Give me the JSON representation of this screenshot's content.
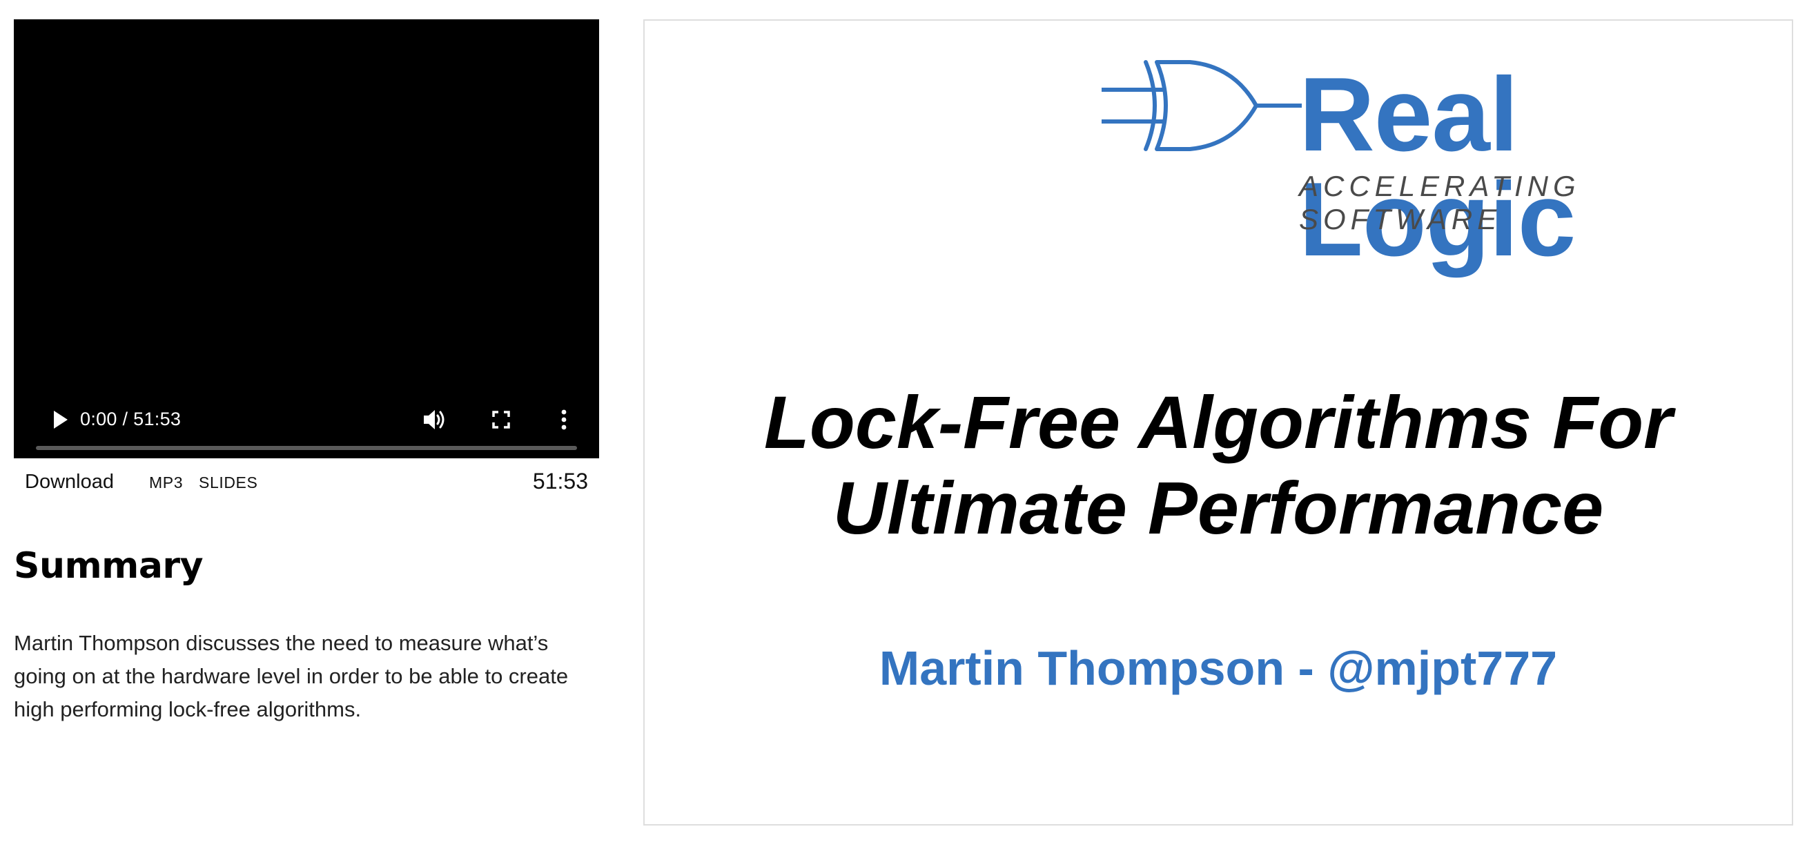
{
  "video": {
    "time_display": "0:00 / 51:53",
    "progress": 0,
    "icons": {
      "play": "play-icon",
      "volume": "volume-icon",
      "fullscreen": "fullscreen-icon",
      "more": "more-vertical-icon"
    }
  },
  "download_bar": {
    "download_label": "Download",
    "links": [
      "MP3",
      "SLIDES"
    ],
    "duration": "51:53"
  },
  "summary": {
    "heading": "Summary",
    "text": "Martin Thompson discusses the need to measure what’s going on at the hardware level in order to be able to create high performing lock-free algorithms."
  },
  "slide": {
    "logo": {
      "wordmark": "Real Logic",
      "tagline": "ACCELERATING SOFTWARE"
    },
    "title_lines": [
      "Lock-Free Algorithms For",
      "Ultimate Performance"
    ],
    "author": "Martin Thompson - @mjpt777"
  },
  "colors": {
    "brand_blue": "#3474c0",
    "video_background": "#000000",
    "slide_border": "#dedede"
  }
}
